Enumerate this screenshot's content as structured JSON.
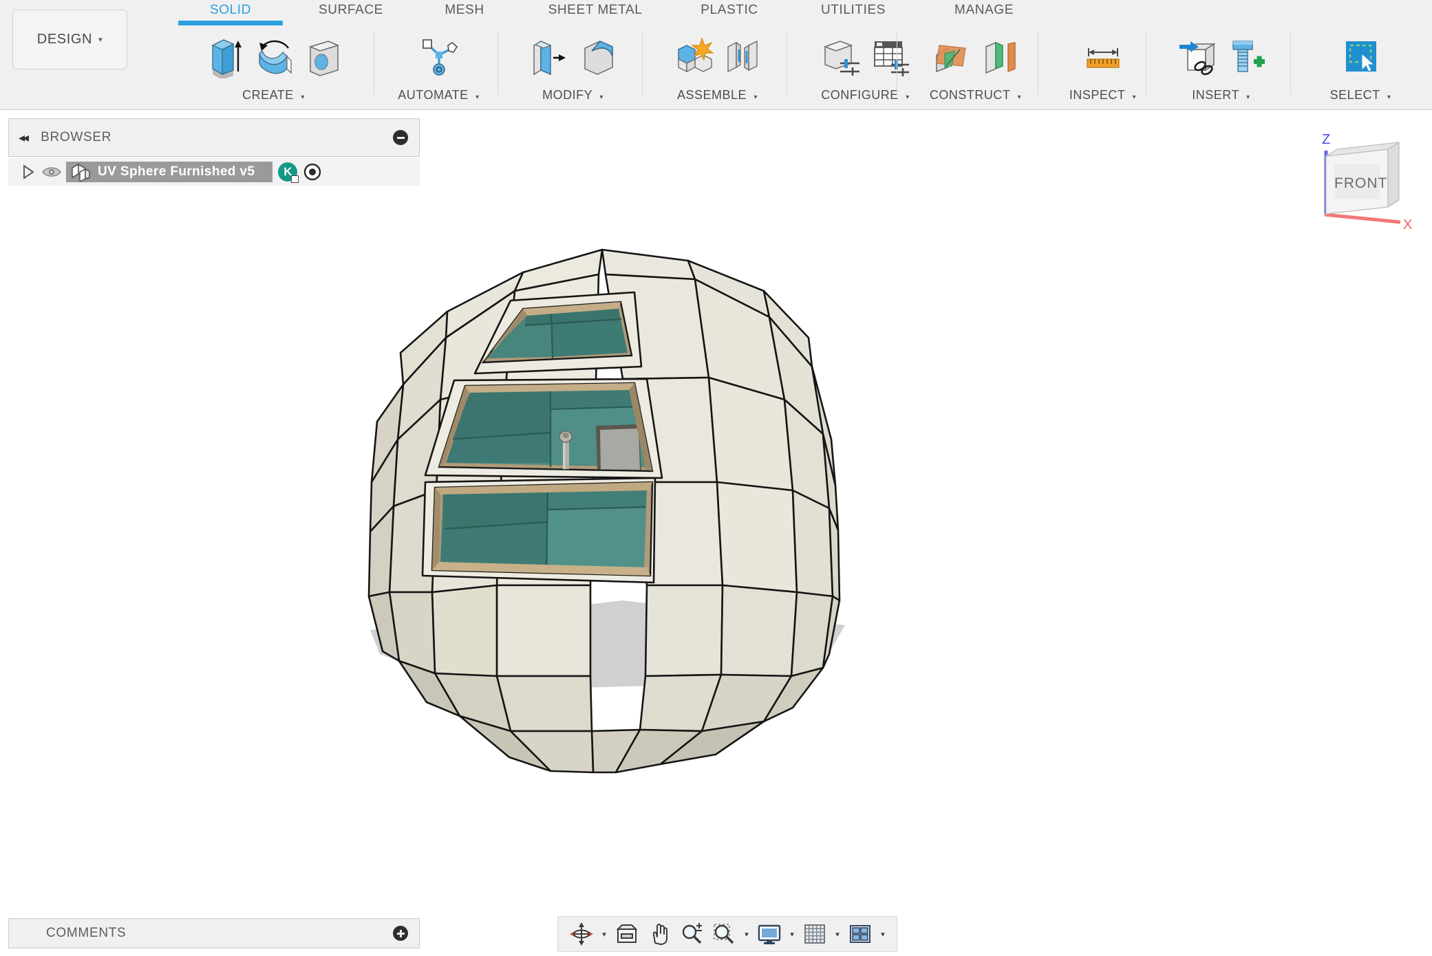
{
  "app": {
    "workspace_label": "DESIGN",
    "workspace_caret": "▾"
  },
  "ribbon": {
    "tabs": [
      {
        "label": "SOLID",
        "active": true
      },
      {
        "label": "SURFACE",
        "active": false
      },
      {
        "label": "MESH",
        "active": false
      },
      {
        "label": "SHEET METAL",
        "active": false
      },
      {
        "label": "PLASTIC",
        "active": false
      },
      {
        "label": "UTILITIES",
        "active": false
      },
      {
        "label": "MANAGE",
        "active": false
      }
    ],
    "panels": [
      {
        "label": "CREATE",
        "caret": "▾",
        "icons": [
          "extrude-icon",
          "revolve-icon",
          "hole-icon"
        ]
      },
      {
        "label": "AUTOMATE",
        "caret": "▾",
        "icons": [
          "automated-modeling-icon"
        ]
      },
      {
        "label": "MODIFY",
        "caret": "▾",
        "icons": [
          "press-pull-icon",
          "fillet-icon"
        ]
      },
      {
        "label": "ASSEMBLE",
        "caret": "▾",
        "icons": [
          "new-component-icon",
          "joint-icon"
        ]
      },
      {
        "label": "CONFIGURE",
        "caret": "▾",
        "icons": [
          "configuration-icon",
          "configuration-table-icon"
        ]
      },
      {
        "label": "CONSTRUCT",
        "caret": "▾",
        "icons": [
          "offset-plane-icon",
          "plane-along-path-icon"
        ]
      },
      {
        "label": "INSPECT",
        "caret": "▾",
        "icons": [
          "measure-icon"
        ]
      },
      {
        "label": "INSERT",
        "caret": "▾",
        "icons": [
          "insert-derive-icon",
          "insert-mcmaster-icon"
        ]
      },
      {
        "label": "SELECT",
        "caret": "▾",
        "icons": [
          "select-window-icon"
        ]
      }
    ]
  },
  "browser": {
    "title": "BROWSER",
    "collapse_icon": "◂◂",
    "minimize_icon": "minus-circle-icon",
    "tree": [
      {
        "expand_icon": "expand-triangle-icon",
        "visibility_icon": "eye-icon",
        "component_icon": "component-icon",
        "label": "UV Sphere Furnished v5",
        "badge": "K",
        "activate_icon": "activate-target-icon",
        "selected": true
      }
    ]
  },
  "comments": {
    "title": "COMMENTS",
    "add_icon": "plus-circle-icon"
  },
  "viewcube": {
    "face_label": "FRONT",
    "axis_z": "Z",
    "axis_x": "X",
    "axis_z_color": "#4a4ae8",
    "axis_x_color": "#f26161"
  },
  "navbar": {
    "items": [
      {
        "name": "orbit-icon",
        "caret": true
      },
      {
        "name": "look-at-icon",
        "caret": false
      },
      {
        "name": "pan-icon",
        "caret": false
      },
      {
        "name": "zoom-icon",
        "caret": false
      },
      {
        "name": "zoom-window-icon",
        "caret": true
      },
      {
        "name": "display-settings-icon",
        "caret": true
      },
      {
        "name": "grid-snaps-icon",
        "caret": true
      },
      {
        "name": "viewports-icon",
        "caret": true
      }
    ]
  },
  "model": {
    "name": "UV Sphere Furnished",
    "description": "Faceted UV sphere dwelling with three glazed window openings, teal interior walls, wall lamp and doorway",
    "colors": {
      "shell_light": "#e9e7dd",
      "shell_mid": "#dedbcf",
      "shell_dark": "#c9c5b6",
      "shell_shade": "#bdb9a9",
      "glass_teal": "#417f78",
      "glass_teal_light": "#5d9790",
      "frame_wood": "#b09a78",
      "frame_wood_dark": "#8d7a5e",
      "door_gray": "#a9a9a3",
      "edge_line": "#1a1a1a",
      "ground_shadow": "#cccccc",
      "background": "#ffffff"
    }
  }
}
